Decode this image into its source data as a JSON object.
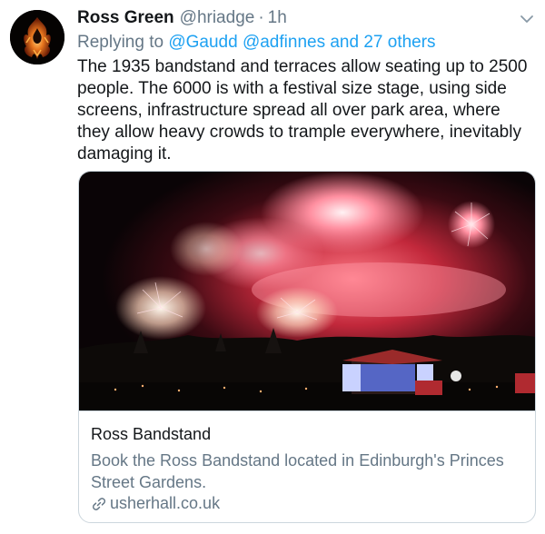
{
  "tweet": {
    "author_name": "Ross Green",
    "author_handle": "@hriadge",
    "separator": "·",
    "timestamp": "1h",
    "reply_prefix": "Replying to ",
    "reply_mentions": "@Gaudd @adfinnes and 27 others",
    "text": "The 1935 bandstand and terraces allow seating up to 2500 people.  The 6000 is with a festival size stage, using side screens, infrastructure spread all over park area, where they allow heavy crowds to trample everywhere, inevitably damaging it."
  },
  "card": {
    "title": "Ross Bandstand",
    "description": "Book the Ross Bandstand located in Edinburgh's Princes Street Gardens.",
    "domain": "usherhall.co.uk",
    "link_icon": "link-icon"
  },
  "icons": {
    "avatar": "flame-logo-avatar",
    "more": "chevron-down-icon"
  },
  "colors": {
    "primary_text": "#14171a",
    "secondary_text": "#657786",
    "link": "#1da1f2",
    "border": "#ccd6dd"
  }
}
